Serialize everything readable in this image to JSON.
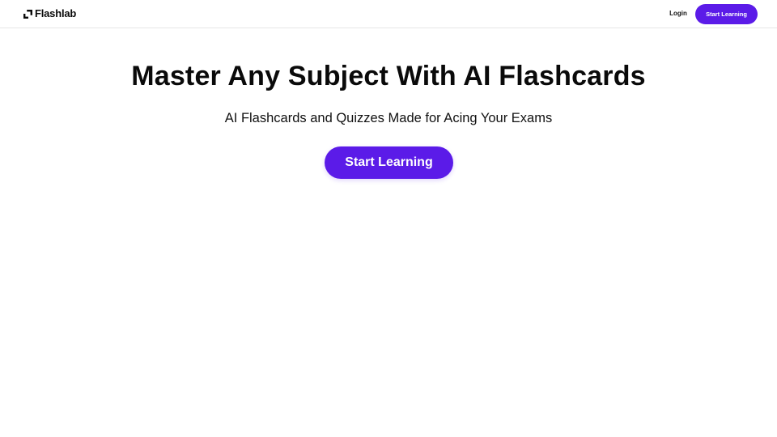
{
  "header": {
    "brand_name": "Flashlab",
    "logo_icon": "flashlab-logo-icon",
    "login_label": "Login",
    "cta_label": "Start Learning"
  },
  "hero": {
    "title": "Master Any Subject With AI Flashcards",
    "subtitle": "AI Flashcards and Quizzes Made for Acing Your Exams",
    "cta_label": "Start Learning"
  },
  "colors": {
    "accent": "#5b1be8",
    "text": "#0a0a0a",
    "background": "#ffffff",
    "divider": "#e6e6e6"
  }
}
